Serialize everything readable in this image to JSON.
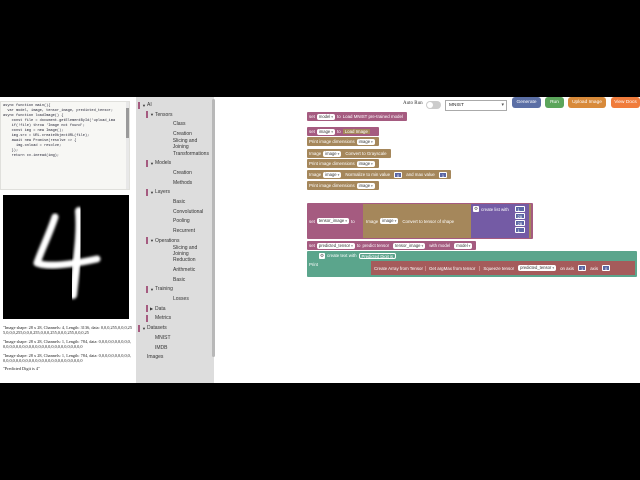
{
  "code_lines": [
    "async function main(){",
    "  var model, image, tensor_image, predicted_tensor;",
    "",
    "async function loadImage() {",
    "    const file = document.getElementById('upload_ima",
    "",
    "    if(!file) throw 'Image not found';",
    "",
    "    const img = new Image();",
    "    img.src = URL.createObjectURL(file);",
    "",
    "    await new Promise(resolve => {",
    "      img.onload = resolve;",
    "    });",
    "",
    "    return cv.imread(img);"
  ],
  "output_logs": [
    "\"Image shape: 28 x 28, Channels: 4, Length: 3136, data: 0,0,0,255,0,0,0,255,0,0,0,255,0,0,0,255,0,0,0,255,0,0,0,255,0,0,0,25",
    "\"Image shape: 28 x 28, Channels: 1, Length: 784, data: 0,0,0,0,0,0,0,0,0,0,0,0,0,0,0,0,0,0,0,0,0,0,0,0,0,0,0,0,0,0,0,0,0,0,0",
    "\"Image shape: 28 x 28, Channels: 1, Length: 784, data: 0,0,0,0,0,0,0,0,0,0,0,0,0,0,0,0,0,0,0,0,0,0,0,0,0,0,0,0,0,0,0,0,0,0,0",
    "\"Predicted Digit is 4\""
  ],
  "toolbar": {
    "auto_run_label": "Auto Run",
    "dataset_value": "MNIST",
    "generate_label": "Generate",
    "run_label": "Run",
    "upload_label": "Upload Image",
    "view_docs_label": "View Docs"
  },
  "toolbox": [
    {
      "label": "AI",
      "level": 0,
      "arrow": "▼",
      "color": "#a55b80"
    },
    {
      "label": "Tensors",
      "level": 1,
      "arrow": "▼",
      "color": "#a55b80"
    },
    {
      "label": "Class",
      "level": 2,
      "arrow": "",
      "color": ""
    },
    {
      "label": "Creation",
      "level": 2,
      "arrow": "",
      "color": ""
    },
    {
      "label": "Slicing and Joining",
      "level": 2,
      "arrow": "",
      "color": ""
    },
    {
      "label": "Transformations",
      "level": 2,
      "arrow": "",
      "color": ""
    },
    {
      "label": "Models",
      "level": 1,
      "arrow": "▼",
      "color": "#a55b80"
    },
    {
      "label": "Creation",
      "level": 2,
      "arrow": "",
      "color": ""
    },
    {
      "label": "Methods",
      "level": 2,
      "arrow": "",
      "color": ""
    },
    {
      "label": "Layers",
      "level": 1,
      "arrow": "▼",
      "color": "#a55b80"
    },
    {
      "label": "Basic",
      "level": 2,
      "arrow": "",
      "color": ""
    },
    {
      "label": "Convolutional",
      "level": 2,
      "arrow": "",
      "color": ""
    },
    {
      "label": "Pooling",
      "level": 2,
      "arrow": "",
      "color": ""
    },
    {
      "label": "Recurrent",
      "level": 2,
      "arrow": "",
      "color": ""
    },
    {
      "label": "Operations",
      "level": 1,
      "arrow": "▼",
      "color": "#a55b80"
    },
    {
      "label": "Slicing and Joining",
      "level": 2,
      "arrow": "",
      "color": ""
    },
    {
      "label": "Reduction",
      "level": 2,
      "arrow": "",
      "color": ""
    },
    {
      "label": "Arithmetic",
      "level": 2,
      "arrow": "",
      "color": ""
    },
    {
      "label": "Basic",
      "level": 2,
      "arrow": "",
      "color": ""
    },
    {
      "label": "Training",
      "level": 1,
      "arrow": "▼",
      "color": "#a55b80"
    },
    {
      "label": "Losses",
      "level": 2,
      "arrow": "",
      "color": ""
    },
    {
      "label": "Data",
      "level": 1,
      "arrow": "▶",
      "color": "#a55b80"
    },
    {
      "label": "Metrics",
      "level": 1,
      "arrow": "",
      "color": "#a55b80"
    },
    {
      "label": "Datasets",
      "level": 0,
      "arrow": "▼",
      "color": "#a55b80"
    },
    {
      "label": "MNIST",
      "level": 1,
      "arrow": "",
      "color": ""
    },
    {
      "label": "IMDB",
      "level": 1,
      "arrow": "",
      "color": ""
    },
    {
      "label": "Images",
      "level": 0,
      "arrow": "",
      "color": ""
    }
  ],
  "blocks": {
    "set_model": {
      "set": "set",
      "var": "model",
      "to": "to",
      "action": "Load MNIST pre-trained model"
    },
    "set_image": {
      "set": "set",
      "var": "image",
      "to": "to",
      "action": "Load Image"
    },
    "print_dims_1": {
      "label": "Print image dimensions",
      "var": "image"
    },
    "gray": {
      "label": "Image",
      "var": "image",
      "action": "Convert to Grayscale"
    },
    "print_dims_2": {
      "label": "Print image dimensions",
      "var": "image"
    },
    "normalize": {
      "label": "Image",
      "var": "image",
      "action": "Normalize to min value",
      "min": "0",
      "and": "and max value",
      "max": "1"
    },
    "print_dims_3": {
      "label": "Print image dimensions",
      "var": "image"
    },
    "set_tensor": {
      "set": "set",
      "var": "tensor_image",
      "to": "to",
      "label": "Image",
      "img": "image",
      "action": "Convert to tensor of shape",
      "list_label": "create list with",
      "shape": [
        "1",
        "28",
        "28",
        "1"
      ]
    },
    "set_pred": {
      "set": "set",
      "var": "predicted_tensor",
      "to": "to",
      "action": "predict tensor",
      "tensor": "tensor_image",
      "with": "with model",
      "model": "model"
    },
    "print_text": {
      "print": "Print",
      "create": "create text with",
      "prefix": "Predicted Digit is ",
      "array": "Create Array from Tensor",
      "argmax": "Get argMax from tensor",
      "squeeze": "Squeeze tensor",
      "tensor": "predicted_tensor",
      "axis_label": "on axis",
      "axis": "1",
      "axis2_label": "axis",
      "axis2": "0"
    }
  },
  "colors": {
    "variable": "#a55b80",
    "image_block": "#a5875b",
    "tensor_list": "#745ba5",
    "text": "#5ba58c",
    "tensor_op": "#a55b5b",
    "number": "#5b67a5",
    "generate_btn": "#5b6fa5",
    "run_btn": "#5ba55b",
    "upload_btn": "#d88a3a",
    "view_docs_btn": "#f07c3c"
  }
}
